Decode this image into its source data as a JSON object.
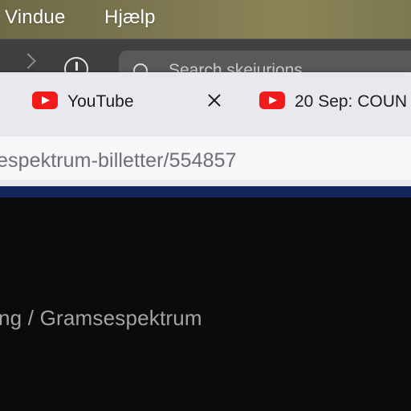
{
  "menubar": {
    "items": [
      "Vindue",
      "Hjælp"
    ]
  },
  "background_window": {
    "search_placeholder": "Search skejurions"
  },
  "tabs": [
    {
      "title": "YouTube",
      "icon": "youtube-icon",
      "active": true
    },
    {
      "title": "20 Sep: COUN",
      "icon": "youtube-icon",
      "active": false
    }
  ],
  "address_bar": {
    "url": "espektrum-billetter/554857"
  },
  "page": {
    "breadcrumb": "ng / Gramsespektrum"
  },
  "colors": {
    "youtube_red": "#f21a1a",
    "header_navy": "#13275c",
    "page_background": "#0b0b0b",
    "tabbar_background": "#e9e8ee"
  }
}
